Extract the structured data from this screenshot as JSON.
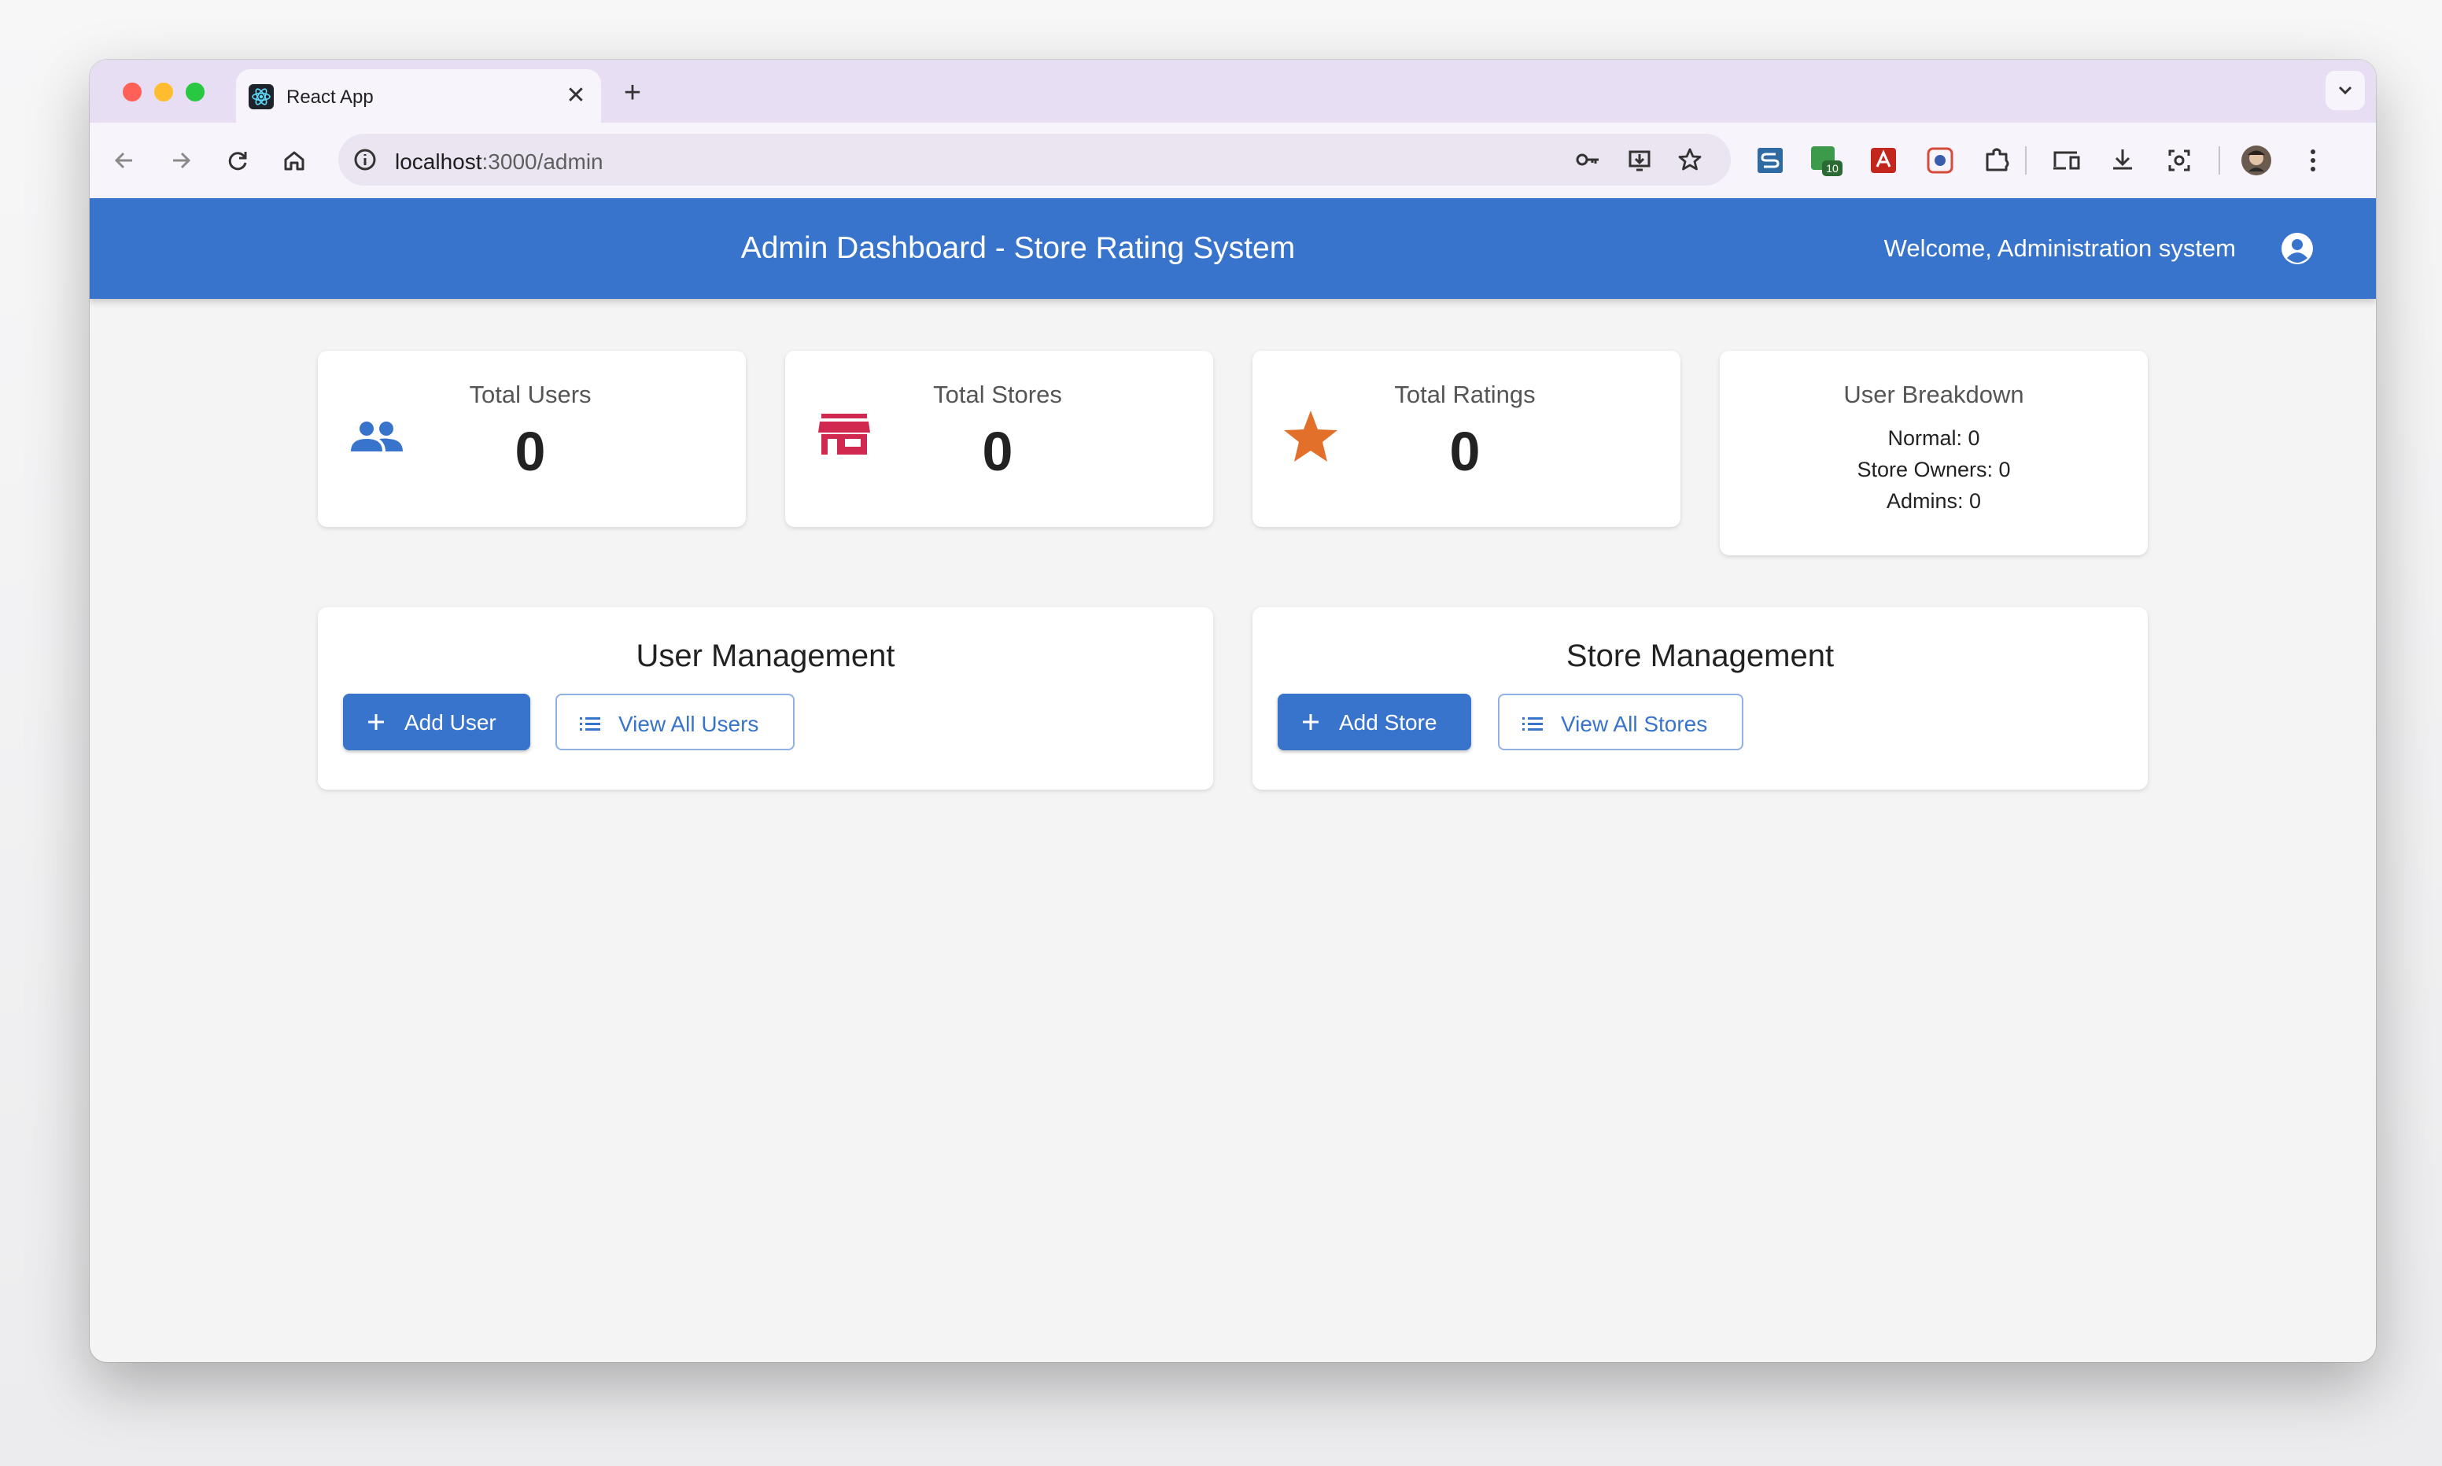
{
  "browser": {
    "tab_title": "React App",
    "tab_close": "✕",
    "new_tab": "+",
    "url_host": "localhost",
    "url_rest": ":3000/admin",
    "extension_badge": "10"
  },
  "header": {
    "title": "Admin Dashboard - Store Rating System",
    "welcome": "Welcome, Administration system"
  },
  "stats": [
    {
      "label": "Total Users",
      "value": "0",
      "icon": "people-icon",
      "color": "#3874cb"
    },
    {
      "label": "Total Stores",
      "value": "0",
      "icon": "storefront-icon",
      "color": "#d0284f"
    },
    {
      "label": "Total Ratings",
      "value": "0",
      "icon": "star-icon",
      "color": "#e2702a"
    }
  ],
  "breakdown": {
    "title": "User Breakdown",
    "normal": "Normal: 0",
    "store_owners": "Store Owners: 0",
    "admins": "Admins: 0"
  },
  "user_management": {
    "title": "User Management",
    "add_label": "Add User",
    "view_label": "View All Users"
  },
  "store_management": {
    "title": "Store Management",
    "add_label": "Add Store",
    "view_label": "View All Stores"
  },
  "colors": {
    "primary": "#3874cb",
    "store_icon": "#d0284f",
    "star_icon": "#e2702a",
    "page_bg": "#f4f4f4"
  }
}
